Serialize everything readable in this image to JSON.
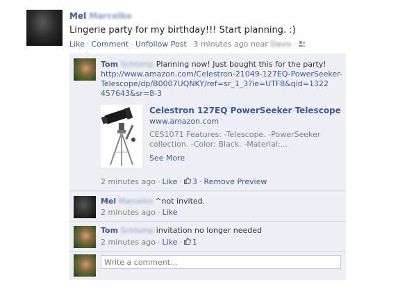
{
  "post": {
    "author_first": "Mel",
    "author_last": "Marcelko",
    "text": "Lingerie party for my birthday!!! Start planning. :)",
    "actions": {
      "like": "Like",
      "comment": "Comment",
      "unfollow": "Unfollow Post"
    },
    "time": "3 minutes ago near",
    "place": "Davis"
  },
  "comments": [
    {
      "author_first": "Tom",
      "author_last": "Schlump",
      "text": "Planning now! Just bought this for the party!",
      "link_lines": [
        "http://www.amazon.com/Celestron-21049-127EQ-PowerSeeker-",
        "Telescope/dp/B0007UQNKY/ref=sr_1_3?ie=UTF8&qid=1322",
        "457643&sr=8-3"
      ],
      "preview": {
        "title": "Celestron 127EQ PowerSeeker Telescope",
        "domain": "www.amazon.com",
        "desc_lines": [
          "CES1071 Features: -Telescope. -PowerSeeker",
          "collection. -Color: Black. -Material:..."
        ],
        "see_more": "See More"
      },
      "time": "2 minutes ago",
      "like": "Like",
      "likes": "3",
      "remove": "Remove Preview"
    },
    {
      "author_first": "Mel",
      "author_last": "Marcelko",
      "text": "^not invited.",
      "time": "2 minutes ago",
      "like": "Like"
    },
    {
      "author_first": "Tom",
      "author_last": "Schlump",
      "text": "invitation no longer needed",
      "time": "2 minutes ago",
      "like": "Like",
      "likes": "1"
    }
  ],
  "composer": {
    "placeholder": "Write a comment..."
  },
  "icons": {
    "friends": "friends-icon",
    "thumb": "thumbs-up-icon"
  },
  "colors": {
    "link": "#3b5998",
    "comment_bg": "#edeff4"
  }
}
